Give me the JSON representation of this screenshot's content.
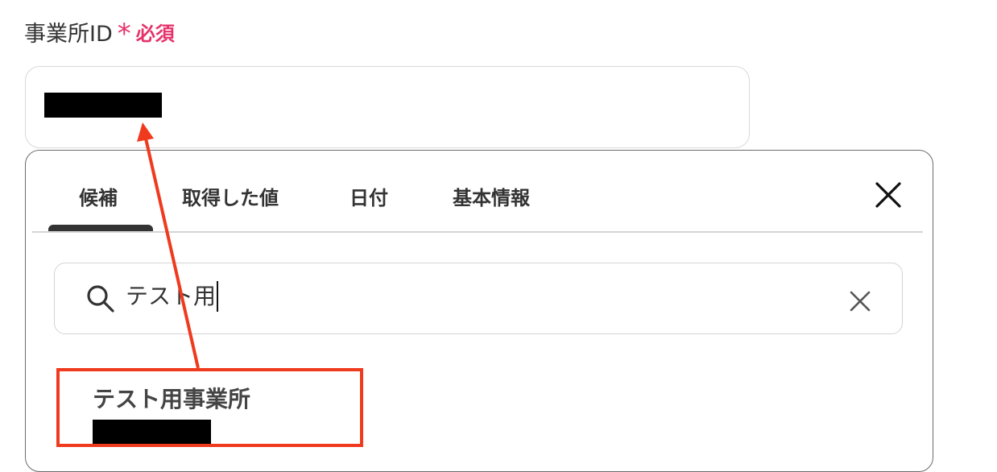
{
  "field": {
    "label": "事業所ID",
    "required_mark": "*",
    "required_text": "必須"
  },
  "tabs": [
    {
      "label": "候補",
      "active": true
    },
    {
      "label": "取得した値",
      "active": false
    },
    {
      "label": "日付",
      "active": false
    },
    {
      "label": "基本情報",
      "active": false
    }
  ],
  "search": {
    "value": "テスト用"
  },
  "results": [
    {
      "name": "テスト用事業所"
    }
  ],
  "icons": {
    "close": "close-icon",
    "search": "search-icon",
    "clear": "clear-icon"
  },
  "colors": {
    "required": "#e5326a",
    "annotation": "#ef3a1e",
    "text": "#333333"
  }
}
